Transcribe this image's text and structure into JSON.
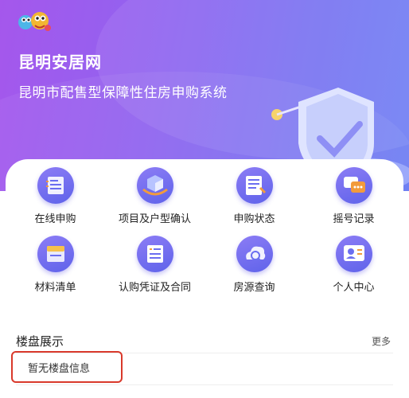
{
  "header": {
    "title": "昆明安居网",
    "subtitle": "昆明市配售型保障性住房申购系统"
  },
  "menu": {
    "items": [
      {
        "label": "在线申购",
        "icon": "online-apply-icon"
      },
      {
        "label": "项目及户型确认",
        "icon": "project-confirm-icon"
      },
      {
        "label": "申购状态",
        "icon": "apply-status-icon"
      },
      {
        "label": "摇号记录",
        "icon": "lottery-record-icon"
      },
      {
        "label": "材料清单",
        "icon": "material-list-icon"
      },
      {
        "label": "认购凭证及合同",
        "icon": "voucher-contract-icon"
      },
      {
        "label": "房源查询",
        "icon": "house-search-icon"
      },
      {
        "label": "个人中心",
        "icon": "personal-center-icon"
      }
    ]
  },
  "listings": {
    "title": "楼盘展示",
    "more": "更多",
    "empty": "暂无楼盘信息"
  },
  "colors": {
    "hero_start": "#a557ec",
    "hero_end": "#6f80f3",
    "icon_accent": "#5f63ea",
    "highlight_border": "#d9392b"
  }
}
